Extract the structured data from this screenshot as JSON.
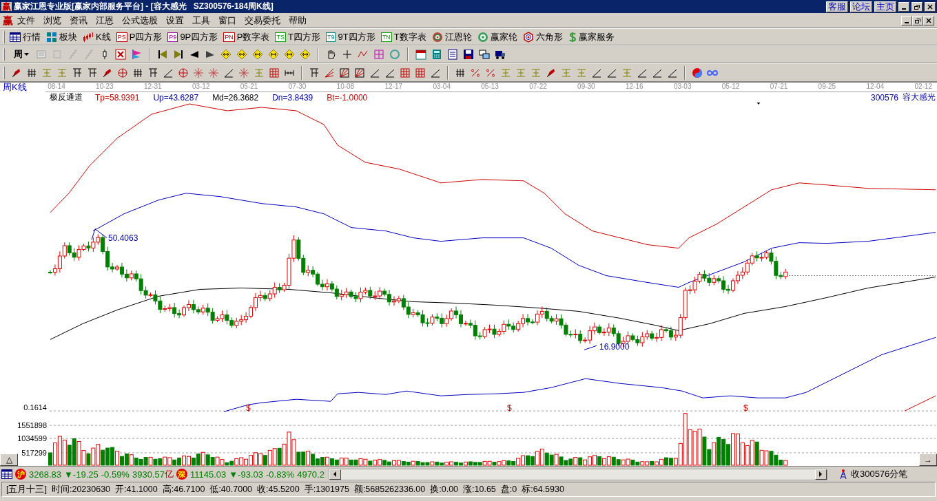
{
  "window": {
    "logo": "赢",
    "title": "赢家江恩专业版[赢家内部服务平台] - [容大感光   SZ300576-184周K线]",
    "links": [
      "客服",
      "论坛",
      "主页"
    ]
  },
  "menu": {
    "logo": "赢",
    "items": [
      "文件",
      "浏览",
      "资讯",
      "江恩",
      "公式选股",
      "设置",
      "工具",
      "窗口",
      "交易委托",
      "帮助"
    ]
  },
  "toolbar": [
    {
      "label": "行情",
      "kind": "table"
    },
    {
      "label": "板块",
      "kind": "blocks"
    },
    {
      "label": "K线",
      "kind": "candles"
    },
    {
      "label": "P四方形",
      "kind": "letter",
      "badge": "PS",
      "color": "#c00000"
    },
    {
      "label": "9P四方形",
      "kind": "letter",
      "badge": "P9",
      "color": "#a000a0"
    },
    {
      "label": "P数字表",
      "kind": "letter",
      "badge": "PN",
      "color": "#c00000"
    },
    {
      "label": "T四方形",
      "kind": "letter",
      "badge": "TS",
      "color": "#00a000"
    },
    {
      "label": "9T四方形",
      "kind": "letter",
      "badge": "T9",
      "color": "#008080"
    },
    {
      "label": "T数字表",
      "kind": "letter",
      "badge": "TN",
      "color": "#00a000"
    },
    {
      "label": "江恩轮",
      "kind": "target"
    },
    {
      "label": "赢家轮",
      "kind": "wheel"
    },
    {
      "label": "六角形",
      "kind": "hexagon"
    },
    {
      "label": "赢家服务",
      "kind": "dollar"
    }
  ],
  "period_selector": "周",
  "chart": {
    "period": "周K线",
    "dates": [
      "08-14",
      "10-23",
      "12-31",
      "03-12",
      "05-21",
      "07-30",
      "10-08",
      "12-17",
      "03-04",
      "05-13",
      "07-22",
      "09-30",
      "12-16",
      "03-03",
      "05-12",
      "07-21",
      "09-25",
      "12-04",
      "02-12"
    ],
    "indicator": {
      "name": "极反通道",
      "params": [
        {
          "text": "Tp=58.9391",
          "color": "#c00000"
        },
        {
          "text": "Up=43.6287",
          "color": "#0000a0"
        },
        {
          "text": "Md=26.3682",
          "color": "#000000"
        },
        {
          "text": "Dn=3.8439",
          "color": "#0000a0"
        },
        {
          "text": "Bt=-1.0000",
          "color": "#c00000"
        }
      ]
    },
    "stock_code": "300576",
    "stock_name": "容大感光",
    "high_label": "50.4063",
    "low_label": "16.9000",
    "lower_axis": "0.1614",
    "signal_marks": [
      "$",
      "$",
      "$"
    ],
    "volume_axis": [
      "1551898",
      "1034599",
      "517299"
    ],
    "collapse_button": "△",
    "next_button": "→"
  },
  "ticker": [
    {
      "badge": "沪",
      "index": "3268.83",
      "change": "▼-19.25",
      "percent": "-0.59%",
      "amount": "3930.57",
      "unit": "亿"
    },
    {
      "badge": "深",
      "index": "11145.03",
      "change": "▼-93.03",
      "percent": "-0.83%",
      "amount": "4970.2"
    }
  ],
  "feed_status": "收300576分笔",
  "status": [
    "[五月十三]",
    "时间:20230630",
    "开:41.1000",
    "高:46.7100",
    "低:40.7000",
    "收:45.5200",
    "手:1301975",
    "额:5685262336.00",
    "换:0.00",
    "涨:10.65",
    "盘:0",
    "标:64.5930"
  ]
}
